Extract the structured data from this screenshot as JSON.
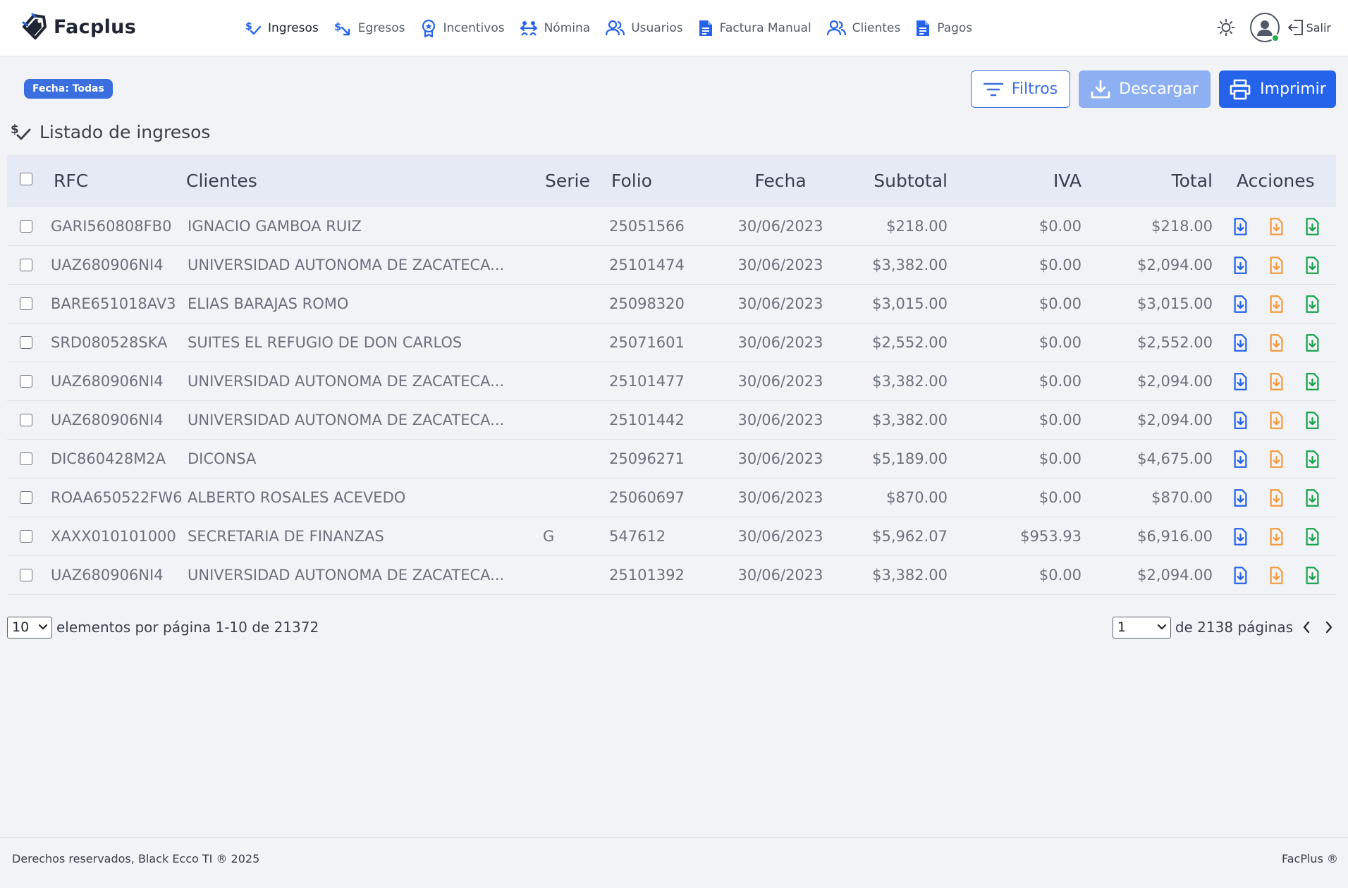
{
  "brand": {
    "name": "Facplus"
  },
  "nav": {
    "items": [
      {
        "label": "Ingresos",
        "icon": "dollar-check-icon",
        "active": true
      },
      {
        "label": "Egresos",
        "icon": "dollar-out-icon",
        "active": false
      },
      {
        "label": "Incentivos",
        "icon": "award-icon",
        "active": false
      },
      {
        "label": "Nómina",
        "icon": "payroll-icon",
        "active": false
      },
      {
        "label": "Usuarios",
        "icon": "users-icon",
        "active": false
      },
      {
        "label": "Factura Manual",
        "icon": "document-icon",
        "active": false
      },
      {
        "label": "Clientes",
        "icon": "clients-icon",
        "active": false
      },
      {
        "label": "Pagos",
        "icon": "document-icon",
        "active": false
      }
    ]
  },
  "user": {
    "logout_label": "Salir",
    "status": "online"
  },
  "toolbar": {
    "date_chip": "Fecha: Todas",
    "filter_label": "Filtros",
    "download_label": "Descargar",
    "print_label": "Imprimir"
  },
  "list": {
    "title": "Listado de ingresos"
  },
  "table": {
    "headers": {
      "rfc": "RFC",
      "client": "Clientes",
      "serie": "Serie",
      "folio": "Folio",
      "fecha": "Fecha",
      "subtotal": "Subtotal",
      "iva": "IVA",
      "total": "Total",
      "acciones": "Acciones"
    },
    "rows": [
      {
        "rfc": "GARI560808FB0",
        "client": "IGNACIO GAMBOA RUIZ",
        "serie": "",
        "folio": "25051566",
        "fecha": "30/06/2023",
        "subtotal": "$218.00",
        "iva": "$0.00",
        "total": "$218.00"
      },
      {
        "rfc": "UAZ680906NI4",
        "client": "UNIVERSIDAD AUTONOMA DE ZACATECA...",
        "serie": "",
        "folio": "25101474",
        "fecha": "30/06/2023",
        "subtotal": "$3,382.00",
        "iva": "$0.00",
        "total": "$2,094.00"
      },
      {
        "rfc": "BARE651018AV3",
        "client": "ELIAS BARAJAS ROMO",
        "serie": "",
        "folio": "25098320",
        "fecha": "30/06/2023",
        "subtotal": "$3,015.00",
        "iva": "$0.00",
        "total": "$3,015.00"
      },
      {
        "rfc": "SRD080528SKA",
        "client": "SUITES EL REFUGIO DE DON CARLOS",
        "serie": "",
        "folio": "25071601",
        "fecha": "30/06/2023",
        "subtotal": "$2,552.00",
        "iva": "$0.00",
        "total": "$2,552.00"
      },
      {
        "rfc": "UAZ680906NI4",
        "client": "UNIVERSIDAD AUTONOMA DE ZACATECA...",
        "serie": "",
        "folio": "25101477",
        "fecha": "30/06/2023",
        "subtotal": "$3,382.00",
        "iva": "$0.00",
        "total": "$2,094.00"
      },
      {
        "rfc": "UAZ680906NI4",
        "client": "UNIVERSIDAD AUTONOMA DE ZACATECA...",
        "serie": "",
        "folio": "25101442",
        "fecha": "30/06/2023",
        "subtotal": "$3,382.00",
        "iva": "$0.00",
        "total": "$2,094.00"
      },
      {
        "rfc": "DIC860428M2A",
        "client": "DICONSA",
        "serie": "",
        "folio": "25096271",
        "fecha": "30/06/2023",
        "subtotal": "$5,189.00",
        "iva": "$0.00",
        "total": "$4,675.00"
      },
      {
        "rfc": "ROAA650522FW6",
        "client": "ALBERTO ROSALES ACEVEDO",
        "serie": "",
        "folio": "25060697",
        "fecha": "30/06/2023",
        "subtotal": "$870.00",
        "iva": "$0.00",
        "total": "$870.00"
      },
      {
        "rfc": "XAXX010101000",
        "client": "SECRETARIA DE FINANZAS",
        "serie": "G",
        "folio": "547612",
        "fecha": "30/06/2023",
        "subtotal": "$5,962.07",
        "iva": "$953.93",
        "total": "$6,916.00"
      },
      {
        "rfc": "UAZ680906NI4",
        "client": "UNIVERSIDAD AUTONOMA DE ZACATECA...",
        "serie": "",
        "folio": "25101392",
        "fecha": "30/06/2023",
        "subtotal": "$3,382.00",
        "iva": "$0.00",
        "total": "$2,094.00"
      }
    ],
    "row_actions": [
      {
        "icon": "download-file-icon",
        "color": "#2563eb"
      },
      {
        "icon": "download-file-icon",
        "color": "#f59a3c"
      },
      {
        "icon": "download-file-icon",
        "color": "#16a34a"
      }
    ]
  },
  "pagination": {
    "page_size": "10",
    "range_text": "elementos por página 1-10 de 21372",
    "current_page": "1",
    "pages_text": "de 2138 páginas"
  },
  "footer": {
    "left": "Derechos reservados, Black Ecco TI ® 2025",
    "right": "FacPlus ®"
  },
  "colors": {
    "accent": "#2563eb",
    "accent_light": "#8db0f2",
    "chip": "#3b6fe0",
    "header_bg": "#e6eaf4",
    "page_bg": "#f1f3f7",
    "orange": "#f59a3c",
    "green": "#16a34a"
  }
}
